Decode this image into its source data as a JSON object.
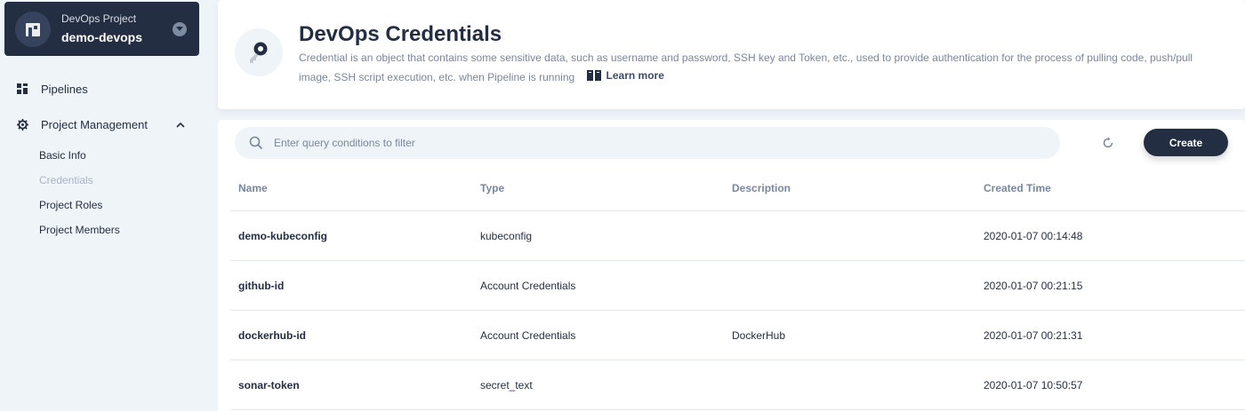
{
  "project": {
    "kind": "DevOps Project",
    "name": "demo-devops"
  },
  "nav": {
    "pipelines": "Pipelines",
    "project_management": "Project Management",
    "sub_items": [
      "Basic Info",
      "Credentials",
      "Project Roles",
      "Project Members"
    ],
    "active_sub_item": "Credentials"
  },
  "header": {
    "title": "DevOps Credentials",
    "description": "Credential is an object that contains some sensitive data, such as username and password, SSH key and Token, etc., used to provide authentication for the process of pulling code, push/pull image, SSH script execution, etc. when Pipeline is running",
    "learn_more": "Learn more"
  },
  "toolbar": {
    "search_placeholder": "Enter query conditions to filter",
    "create_label": "Create"
  },
  "table": {
    "columns": [
      "Name",
      "Type",
      "Description",
      "Created Time"
    ],
    "rows": [
      {
        "name": "demo-kubeconfig",
        "type": "kubeconfig",
        "description": "",
        "created": "2020-01-07 00:14:48"
      },
      {
        "name": "github-id",
        "type": "Account Credentials",
        "description": "",
        "created": "2020-01-07 00:21:15"
      },
      {
        "name": "dockerhub-id",
        "type": "Account Credentials",
        "description": "DockerHub",
        "created": "2020-01-07 00:21:31"
      },
      {
        "name": "sonar-token",
        "type": "secret_text",
        "description": "",
        "created": "2020-01-07 10:50:57"
      }
    ]
  },
  "icons": {
    "project": "devops-project-icon",
    "pipelines": "pipelines-icon",
    "project_management": "gear-icon",
    "header": "key-icon",
    "search": "search-icon",
    "refresh": "refresh-icon"
  },
  "colors": {
    "dark": "#242e42",
    "muted": "#79879c",
    "background": "#eff4f9",
    "active_sub_item": "#a9b4c2"
  }
}
